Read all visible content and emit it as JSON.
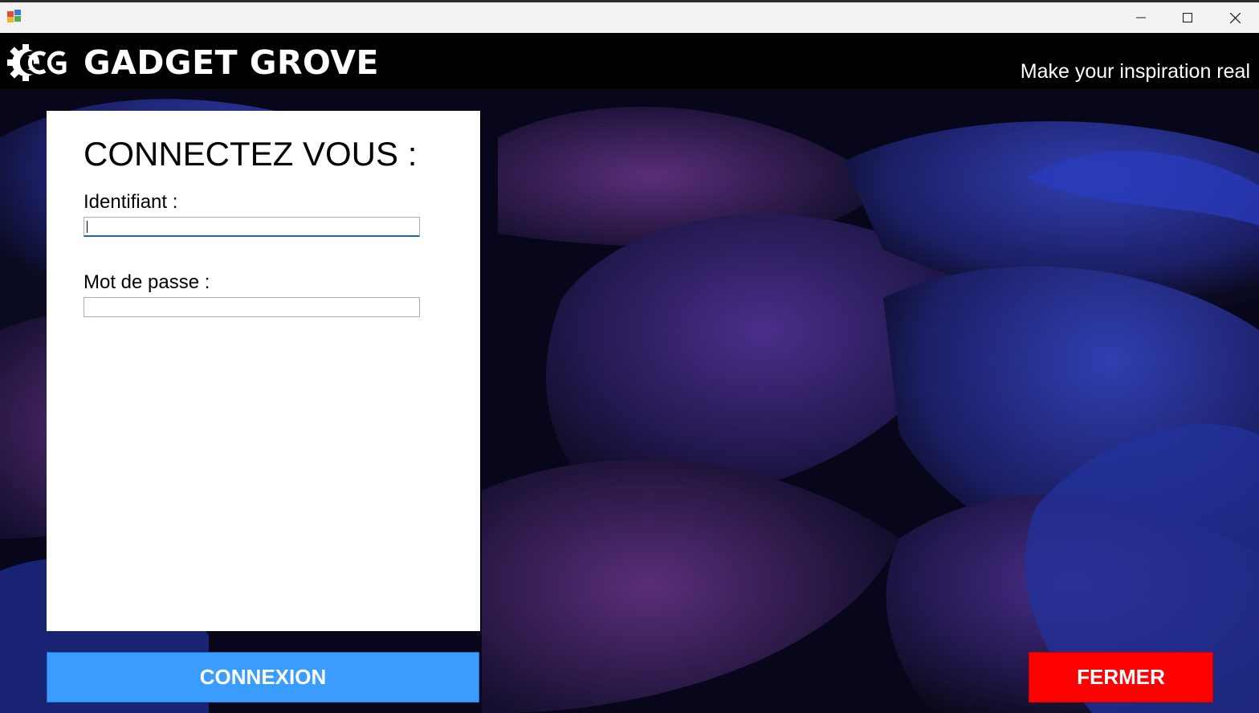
{
  "window": {
    "controls": [
      "minimize-icon",
      "maximize-icon",
      "close-icon"
    ]
  },
  "header": {
    "brand": "GADGET GROVE",
    "slogan": "Make your inspiration real",
    "logo_icon": "gear-cg-logo-icon"
  },
  "login": {
    "title": "CONNECTEZ VOUS :",
    "username_label": "Identifiant :",
    "username_value": "",
    "password_label": "Mot de passe :",
    "password_value": ""
  },
  "buttons": {
    "connect_label": "CONNEXION",
    "close_label": "FERMER"
  },
  "colors": {
    "connect": "#3a9cff",
    "close": "#ff0000",
    "header": "#000000"
  }
}
